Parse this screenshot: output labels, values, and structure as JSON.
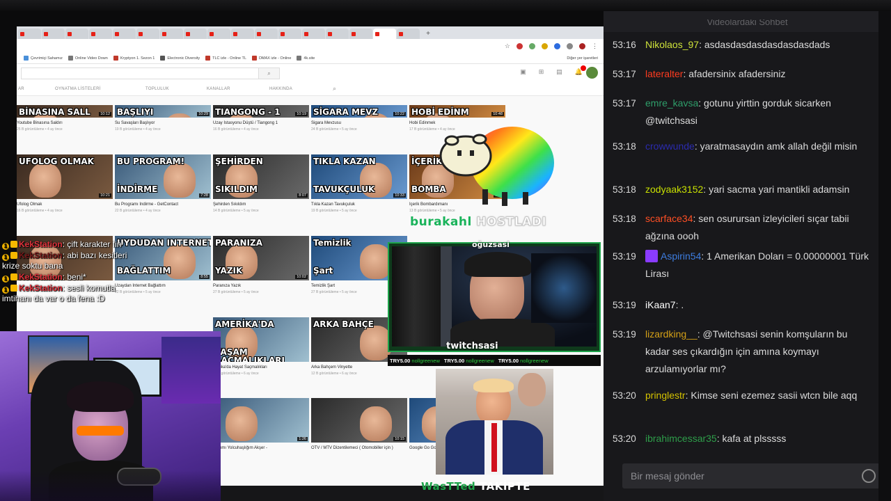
{
  "browser": {
    "tabs_count": 17,
    "bookmarks": [
      {
        "label": "Çevrimiçi Sahamız",
        "color": "#4a90d9"
      },
      {
        "label": "Online Video Down",
        "color": "#777"
      },
      {
        "label": "Kryptyon 1. Sezon 1",
        "color": "#c0392b"
      },
      {
        "label": "Electronic Diversity",
        "color": "#555"
      },
      {
        "label": "TLC izle - Online TL",
        "color": "#c0392b"
      },
      {
        "label": "DMAX izle - Online",
        "color": "#c0392b"
      },
      {
        "label": "4k.site",
        "color": "#777"
      }
    ],
    "bookmarks_other": "Diğer yer işaretleri",
    "channel_tabs": [
      "AR",
      "OYNATMA LİSTELERİ",
      "TOPLULUK",
      "KANALLAR",
      "HAKKINDA"
    ],
    "videos_row1": [
      {
        "thumb": "BİNASINA SALL",
        "title": "Youtube Binasına Saldırı",
        "meta": "25 B görüntüleme • 4 ay önce",
        "dur": "10:12"
      },
      {
        "thumb": "BAŞLIYI",
        "title": "Su Savaşları Başlıyor",
        "meta": "19 B görüntüleme • 4 ay önce",
        "dur": "10:29"
      },
      {
        "thumb": "TIANGONG - 1",
        "title": "Uzay İstasyonu Düştü / Tiangong 1",
        "meta": "16 B görüntüleme • 4 ay önce",
        "dur": "10:19"
      },
      {
        "thumb": "SİGARA MEVZ",
        "title": "Sigara Mevzusu",
        "meta": "24 B görüntüleme • 5 ay önce",
        "dur": "10:22"
      },
      {
        "thumb": "HOBİ EDİNM",
        "title": "Hobi Edinmek",
        "meta": "17 B görüntüleme • 4 ay önce",
        "dur": "10:48"
      }
    ],
    "videos_row2": [
      {
        "thumb": "UFOLOG OLMAK",
        "title": "Ufolog Olmak",
        "meta": "16 B görüntüleme • 4 ay önce",
        "dur": "10:21"
      },
      {
        "thumb": "BU PROGRAM!",
        "thumb2": "İNDİRME",
        "title": "Bu Programı İndirme - GetContact",
        "meta": "22 B görüntüleme • 4 ay önce",
        "dur": "7:28"
      },
      {
        "thumb": "ŞEHİRDEN",
        "thumb2": "SIKILDIM",
        "title": "Şehirden Sıkıldım",
        "meta": "14 B görüntüleme • 5 ay önce",
        "dur": "8:07"
      },
      {
        "thumb": "TIKLA KAZAN",
        "thumb2": "TAVUKÇULUK",
        "title": "Tıkla Kazan Tavukçuluk",
        "meta": "19 B görüntüleme • 5 ay önce",
        "dur": "10:33"
      },
      {
        "thumb": "İÇERİK",
        "thumb2": "BOMBA",
        "title": "İçerik Bombardımanı",
        "meta": "13 B görüntüleme • 5 ay önce",
        "dur": "9:54"
      }
    ],
    "videos_row3": [
      {
        "thumb": "",
        "title": "",
        "meta": "",
        "dur": ""
      },
      {
        "thumb": "UYDUDAN INTERNET",
        "thumb2": "BAĞLATTIM",
        "title": "Uzaydan İnternet Bağlattım",
        "meta": "22 B görüntüleme • 5 ay önce",
        "dur": "8:55"
      },
      {
        "thumb": "PARANIZA",
        "thumb2": "YAZIK",
        "title": "Paranıza Yazık",
        "meta": "27 B görüntüleme • 5 ay önce",
        "dur": "10:02"
      },
      {
        "thumb": "Temizlik",
        "thumb2": "Şart",
        "title": "Temizlik Şart",
        "meta": "27 B görüntüleme • 5 ay önce",
        "dur": ""
      }
    ],
    "videos_row4": [
      {
        "thumb": "AMERİKA'DA",
        "thumb2": "YAŞAM",
        "thumb3": "SAÇMALIKLARI",
        "title": "merika'da Hayat Saçmalıkları",
        "meta": "24 B görüntüleme • 6 ay önce",
        "dur": ""
      },
      {
        "thumb": "ARKA BAHÇE",
        "title": "Arka Bahçem Vinyette",
        "meta": "12 B görüntüleme • 6 ay önce",
        "dur": ""
      }
    ],
    "videos_row5": [
      {
        "title": "Kapımı Yolcuhaşlığım Akşer -",
        "meta": "",
        "dur": "1:26"
      },
      {
        "title": "OTV / MTV Dizentilemeci ( Otomobiller için )",
        "meta": "",
        "dur": "10:15"
      },
      {
        "title": "Google Go Googles",
        "meta": "",
        "dur": ""
      }
    ]
  },
  "sheep_overlay": {
    "brand_green": "burakahl",
    "brand_white": "HOSTLADI"
  },
  "cam": {
    "label": "twitchsasi",
    "top_tag": "oğuzsasi"
  },
  "donations": [
    {
      "amount": "TRY5.00",
      "user": "nollgreenew"
    },
    {
      "amount": "TRY5.00",
      "user": "nollgreenew"
    },
    {
      "amount": "TRY5.00",
      "user": "nollgreenew"
    }
  ],
  "bottom_tag": {
    "green": "WasTTed",
    "white": "TAKİPTE"
  },
  "overlay_chat": [
    {
      "user": "KekStation",
      "text": ": çift karakter fin",
      "dim": false
    },
    {
      "user": "KekStation",
      "text": ": abi bazı kesitleri krize soktu bana",
      "dim": true
    },
    {
      "user": "KekStation",
      "text": ": beni*",
      "dim": false
    },
    {
      "user": "KekStation",
      "text": ": sesli komutla imtihanı da var o da fena :D",
      "dim": false
    }
  ],
  "chat": {
    "header": "Videolardaki Sohbet",
    "input_placeholder": "Bir mesaj gönder",
    "messages": [
      {
        "time": "53:16",
        "user": "Nikolaos_97",
        "color": "#cfe33a",
        "text": "asdasdasdasdasdasdasdads"
      },
      {
        "time": "53:17",
        "user": "lateralter",
        "color": "#ff3b1f",
        "text": "afadersinix afadersiniz"
      },
      {
        "time": "53:17",
        "user": "emre_kavsa",
        "color": "#2e9e6a",
        "text": "gotunu yirttin gorduk sicarken @twitchsasi"
      },
      {
        "time": "53:18",
        "user": "crowwunde",
        "color": "#2b2bb0",
        "text": "yaratmasaydın amk allah değil misin"
      },
      {
        "time": "53:18",
        "user": "zodyaak3152",
        "color": "#c8e000",
        "text": "yari sacma yari mantikli adamsin"
      },
      {
        "time": "53:18",
        "user": "scarface34",
        "color": "#ff4f24",
        "text": "sen osurursan izleyicileri sıçar tabii ağzına oooh"
      },
      {
        "time": "53:19",
        "user": "Aspirin54",
        "color": "#3d7de0",
        "text": "1 Amerikan Doları = 0.00000001 Türk Lirası",
        "badge": true
      },
      {
        "time": "53:19",
        "user": "iKaan7",
        "color": "#ffffff",
        "text": "."
      },
      {
        "time": "53:19",
        "user": "lizardking__",
        "color": "#d4a017",
        "text": "@Twitchsasi senin komşuların bu kadar ses çıkardığın için amına koymayı arzulamıyorlar mı?"
      },
      {
        "time": "53:20",
        "user": "pringlestr",
        "color": "#d4c200",
        "text": "Kimse seni ezemez sasii wtcn bile aqq"
      },
      {
        "time": "53:20",
        "user": "ibrahimcessar35",
        "color": "#2e9e4a",
        "text": "kafa at plsssss"
      }
    ]
  }
}
